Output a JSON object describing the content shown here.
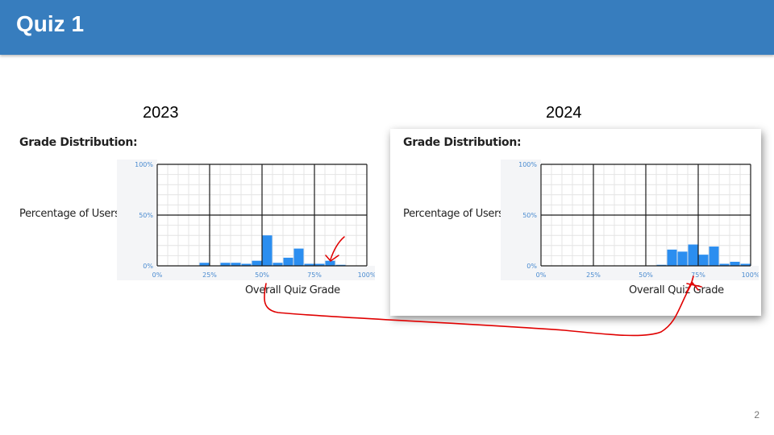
{
  "slide": {
    "title": "Quiz 1",
    "page_number": "2"
  },
  "panels": [
    {
      "year": "2023",
      "heading": "Grade Distribution:",
      "y_axis_label": "Percentage of Users",
      "x_axis_label": "Overall Quiz Grade"
    },
    {
      "year": "2024",
      "heading": "Grade Distribution:",
      "y_axis_label": "Percentage of Users",
      "x_axis_label": "Overall Quiz Grade"
    }
  ],
  "colors": {
    "title_bar": "#377dbe",
    "bar": "#2b8ef0",
    "annotation": "#e00000"
  },
  "chart_data": [
    {
      "type": "bar",
      "title": "Grade Distribution:",
      "xlabel": "Overall Quiz Grade",
      "ylabel": "Percentage of Users",
      "x_ticks": [
        "0%",
        "25%",
        "50%",
        "75%",
        "100%"
      ],
      "y_ticks": [
        "0%",
        "50%",
        "100%"
      ],
      "xlim": [
        0,
        100
      ],
      "ylim": [
        0,
        100
      ],
      "bin_width": 5,
      "bins": [
        0,
        5,
        10,
        15,
        20,
        25,
        30,
        35,
        40,
        45,
        50,
        55,
        60,
        65,
        70,
        75,
        80,
        85,
        90,
        95
      ],
      "values": [
        0,
        0,
        0,
        0,
        3,
        0,
        3,
        3,
        2,
        5,
        30,
        3,
        8,
        17,
        2,
        2,
        5,
        1,
        0,
        0
      ],
      "grid": true
    },
    {
      "type": "bar",
      "title": "Grade Distribution:",
      "xlabel": "Overall Quiz Grade",
      "ylabel": "Percentage of Users",
      "x_ticks": [
        "0%",
        "25%",
        "50%",
        "75%",
        "100%"
      ],
      "y_ticks": [
        "0%",
        "50%",
        "100%"
      ],
      "xlim": [
        0,
        100
      ],
      "ylim": [
        0,
        100
      ],
      "bin_width": 5,
      "bins": [
        0,
        5,
        10,
        15,
        20,
        25,
        30,
        35,
        40,
        45,
        50,
        55,
        60,
        65,
        70,
        75,
        80,
        85,
        90,
        95
      ],
      "values": [
        0,
        0,
        0,
        0,
        0,
        0,
        0,
        0,
        0,
        0,
        0,
        1,
        16,
        14,
        21,
        11,
        19,
        2,
        4,
        2
      ],
      "grid": true
    }
  ]
}
